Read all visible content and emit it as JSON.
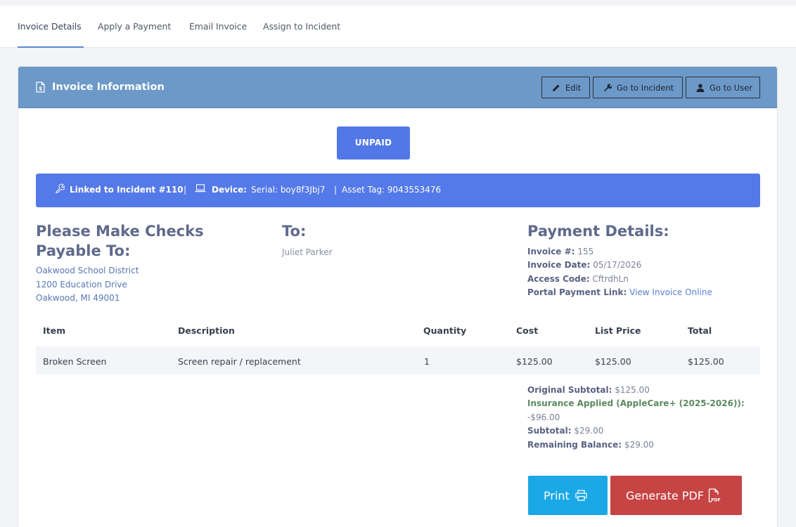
{
  "tabs": [
    {
      "label": "Invoice Details",
      "active": true
    },
    {
      "label": "Apply a Payment",
      "active": false
    },
    {
      "label": "Email Invoice",
      "active": false
    },
    {
      "label": "Assign to Incident",
      "active": false
    }
  ],
  "card": {
    "title": "Invoice Information",
    "buttons": {
      "edit": "Edit",
      "incident": "Go to Incident",
      "user": "Go to User"
    }
  },
  "status": "UNPAID",
  "incident_bar": {
    "linked": "Linked to Incident #110",
    "separator": "|",
    "device_label": "Device:",
    "serial": "Serial: boy8f3Jbj7",
    "separator2": "|",
    "asset_tag": "Asset Tag: 9043553476"
  },
  "payable": {
    "heading_line1": "Please Make Checks",
    "heading_line2": "Payable To:",
    "name": "Oakwood School District",
    "street": "1200 Education Drive",
    "city": "Oakwood, MI 49001"
  },
  "to": {
    "heading": "To:",
    "name": "Juliet Parker"
  },
  "payment_details": {
    "heading": "Payment Details:",
    "invoice_no_label": "Invoice #:",
    "invoice_no": "155",
    "invoice_date_label": "Invoice Date:",
    "invoice_date": "05/17/2026",
    "access_code_label": "Access Code:",
    "access_code": "CftrdhLn",
    "portal_label": "Portal Payment Link:",
    "portal_link": "View Invoice Online"
  },
  "table": {
    "headers": [
      "Item",
      "Description",
      "Quantity",
      "Cost",
      "List Price",
      "Total"
    ],
    "rows": [
      [
        "Broken Screen",
        "Screen repair / replacement",
        "1",
        "$125.00",
        "$125.00",
        "$125.00"
      ]
    ]
  },
  "summary": {
    "original_subtotal_label": "Original Subtotal:",
    "original_subtotal": "$125.00",
    "insurance_label": "Insurance Applied (AppleCare+ (2025-2026)):",
    "insurance_value": "-$96.00",
    "subtotal_label": "Subtotal:",
    "subtotal": "$29.00",
    "remaining_label": "Remaining Balance:",
    "remaining": "$29.00"
  },
  "actions": {
    "print": "Print",
    "pdf": "Generate PDF"
  },
  "colors": {
    "header": "#6c99c8",
    "status": "#5178e6",
    "incident_bar": "#5479e8",
    "print": "#1ba8e6",
    "pdf": "#c64444"
  }
}
